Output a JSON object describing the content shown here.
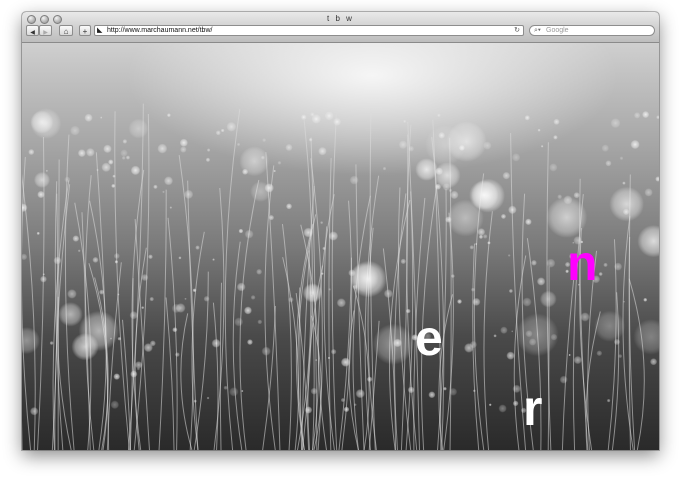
{
  "window": {
    "title": "t b w"
  },
  "toolbar": {
    "back_label": "◀",
    "forward_label": "▶",
    "home_label": "⌂",
    "add_label": "+",
    "url": "http://www.marchaumann.net/tbw/",
    "reload_label": "↻",
    "search_placeholder": "Google"
  },
  "content": {
    "letters": [
      {
        "text": "n",
        "color": "#ff00ff"
      },
      {
        "text": "e",
        "color": "#ffffff"
      },
      {
        "text": "r",
        "color": "#ffffff"
      }
    ]
  },
  "icons": {
    "back": "back-arrow-icon",
    "forward": "forward-arrow-icon",
    "home": "home-icon",
    "add": "plus-icon",
    "favicon": "site-favicon-icon",
    "reload": "reload-icon",
    "search": "magnifier-icon"
  }
}
